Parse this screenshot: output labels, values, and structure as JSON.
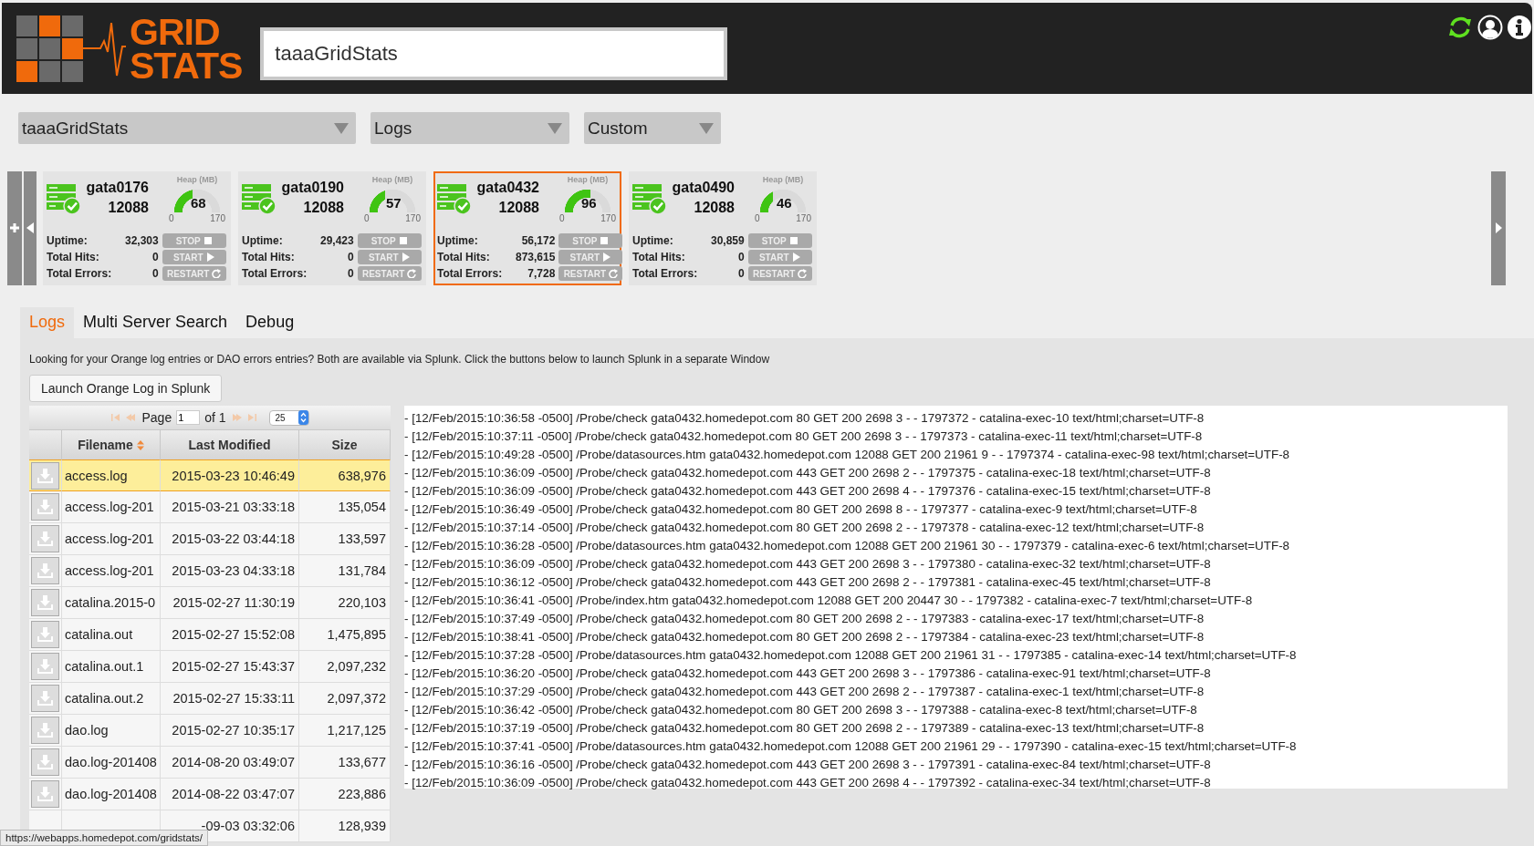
{
  "header": {
    "logo": [
      "GRID",
      "STATS"
    ],
    "search": {
      "value": "taaaGridStats"
    }
  },
  "selectors": [
    {
      "value": "taaaGridStats"
    },
    {
      "value": "Logs"
    },
    {
      "value": "Custom"
    }
  ],
  "servers": [
    {
      "name": "gata0176",
      "port": "12088",
      "heap_label": "Heap (MB)",
      "heap": "68",
      "level": 0.4,
      "min": "0",
      "max": "170",
      "selected": false,
      "stats": [
        {
          "label": "Uptime:",
          "value": "32,303"
        },
        {
          "label": "Total Hits:",
          "value": "0"
        },
        {
          "label": "Total Errors:",
          "value": "0"
        }
      ],
      "actions": [
        {
          "kind": "stop",
          "label": "STOP"
        },
        {
          "kind": "start",
          "label": "START"
        },
        {
          "kind": "restart",
          "label": "RESTART"
        }
      ]
    },
    {
      "name": "gata0190",
      "port": "12088",
      "heap_label": "Heap (MB)",
      "heap": "57",
      "level": 0.335,
      "min": "0",
      "max": "170",
      "selected": false,
      "stats": [
        {
          "label": "Uptime:",
          "value": "29,423"
        },
        {
          "label": "Total Hits:",
          "value": "0"
        },
        {
          "label": "Total Errors:",
          "value": "0"
        }
      ],
      "actions": [
        {
          "kind": "stop",
          "label": "STOP"
        },
        {
          "kind": "start",
          "label": "START"
        },
        {
          "kind": "restart",
          "label": "RESTART"
        }
      ]
    },
    {
      "name": "gata0432",
      "port": "12088",
      "heap_label": "Heap (MB)",
      "heap": "96",
      "level": 0.565,
      "min": "0",
      "max": "170",
      "selected": true,
      "stats": [
        {
          "label": "Uptime:",
          "value": "56,172"
        },
        {
          "label": "Total Hits:",
          "value": "873,615"
        },
        {
          "label": "Total Errors:",
          "value": "7,728"
        }
      ],
      "actions": [
        {
          "kind": "stop",
          "label": "STOP"
        },
        {
          "kind": "start",
          "label": "START"
        },
        {
          "kind": "restart",
          "label": "RESTART"
        }
      ]
    },
    {
      "name": "gata0490",
      "port": "12088",
      "heap_label": "Heap (MB)",
      "heap": "46",
      "level": 0.27,
      "min": "0",
      "max": "170",
      "selected": false,
      "stats": [
        {
          "label": "Uptime:",
          "value": "30,859"
        },
        {
          "label": "Total Hits:",
          "value": "0"
        },
        {
          "label": "Total Errors:",
          "value": "0"
        }
      ],
      "actions": [
        {
          "kind": "stop",
          "label": "STOP"
        },
        {
          "kind": "start",
          "label": "START"
        },
        {
          "kind": "restart",
          "label": "RESTART"
        }
      ]
    }
  ],
  "tabs": [
    {
      "label": "Logs",
      "selected": true
    },
    {
      "label": "Multi Server Search",
      "selected": false
    },
    {
      "label": "Debug",
      "selected": false
    }
  ],
  "logs_panel": {
    "notice": "Looking for your Orange log entries or DAO errors entries? Both are available via Splunk. Click the buttons below to launch Splunk in a separate Window",
    "launch_button": "Launch Orange Log in Splunk",
    "pager": {
      "page_label": "Page",
      "page": "1",
      "of": "of 1",
      "page_size": "25"
    },
    "table": {
      "columns": [
        {
          "label": "Filename",
          "sorted": true
        },
        {
          "label": "Last Modified",
          "sorted": false
        },
        {
          "label": "Size",
          "sorted": false
        }
      ],
      "rows": [
        {
          "filename": "access.log",
          "modified": "2015-03-23 10:46:49",
          "size": "638,976",
          "selected": true
        },
        {
          "filename": "access.log-201",
          "modified": "2015-03-21 03:33:18",
          "size": "135,054",
          "selected": false
        },
        {
          "filename": "access.log-201",
          "modified": "2015-03-22 03:44:18",
          "size": "133,597",
          "selected": false
        },
        {
          "filename": "access.log-201",
          "modified": "2015-03-23 04:33:18",
          "size": "131,784",
          "selected": false
        },
        {
          "filename": "catalina.2015-0",
          "modified": "2015-02-27 11:30:19",
          "size": "220,103",
          "selected": false
        },
        {
          "filename": "catalina.out",
          "modified": "2015-02-27 15:52:08",
          "size": "1,475,895",
          "selected": false
        },
        {
          "filename": "catalina.out.1",
          "modified": "2015-02-27 15:43:37",
          "size": "2,097,232",
          "selected": false
        },
        {
          "filename": "catalina.out.2",
          "modified": "2015-02-27 15:33:11",
          "size": "2,097,372",
          "selected": false
        },
        {
          "filename": "dao.log",
          "modified": "2015-02-27 10:35:17",
          "size": "1,217,125",
          "selected": false
        },
        {
          "filename": "dao.log-201408",
          "modified": "2014-08-20 03:49:07",
          "size": "133,677",
          "selected": false
        },
        {
          "filename": "dao.log-201408",
          "modified": "2014-08-22 03:47:07",
          "size": "223,886",
          "selected": false
        },
        {
          "modified": "-09-03 03:32:06",
          "size": "128,939",
          "selected": false
        }
      ]
    },
    "log_lines": [
      "- [12/Feb/2015:10:36:58 -0500] /Probe/check gata0432.homedepot.com 80 GET 200 2698 3 - - 1797372 - catalina-exec-10 text/html;charset=UTF-8",
      "- [12/Feb/2015:10:37:11 -0500] /Probe/check gata0432.homedepot.com 80 GET 200 2698 3 - - 1797373 - catalina-exec-11 text/html;charset=UTF-8",
      "- [12/Feb/2015:10:49:28 -0500] /Probe/datasources.htm gata0432.homedepot.com 12088 GET 200 21961 9 - - 1797374 - catalina-exec-98 text/html;charset=UTF-8",
      "- [12/Feb/2015:10:36:09 -0500] /Probe/check gata0432.homedepot.com 443 GET 200 2698 2 - - 1797375 - catalina-exec-18 text/html;charset=UTF-8",
      "- [12/Feb/2015:10:36:09 -0500] /Probe/check gata0432.homedepot.com 443 GET 200 2698 4 - - 1797376 - catalina-exec-15 text/html;charset=UTF-8",
      "- [12/Feb/2015:10:36:49 -0500] /Probe/check gata0432.homedepot.com 80 GET 200 2698 8 - - 1797377 - catalina-exec-9 text/html;charset=UTF-8",
      "- [12/Feb/2015:10:37:14 -0500] /Probe/check gata0432.homedepot.com 80 GET 200 2698 2 - - 1797378 - catalina-exec-12 text/html;charset=UTF-8",
      "- [12/Feb/2015:10:36:28 -0500] /Probe/datasources.htm gata0432.homedepot.com 12088 GET 200 21961 30 - - 1797379 - catalina-exec-6 text/html;charset=UTF-8",
      "- [12/Feb/2015:10:36:09 -0500] /Probe/check gata0432.homedepot.com 443 GET 200 2698 3 - - 1797380 - catalina-exec-32 text/html;charset=UTF-8",
      "- [12/Feb/2015:10:36:12 -0500] /Probe/check gata0432.homedepot.com 443 GET 200 2698 2 - - 1797381 - catalina-exec-45 text/html;charset=UTF-8",
      "- [12/Feb/2015:10:36:41 -0500] /Probe/index.htm gata0432.homedepot.com 12088 GET 200 20447 30 - - 1797382 - catalina-exec-7 text/html;charset=UTF-8",
      "- [12/Feb/2015:10:37:49 -0500] /Probe/check gata0432.homedepot.com 80 GET 200 2698 2 - - 1797383 - catalina-exec-17 text/html;charset=UTF-8",
      "- [12/Feb/2015:10:38:41 -0500] /Probe/check gata0432.homedepot.com 80 GET 200 2698 2 - - 1797384 - catalina-exec-23 text/html;charset=UTF-8",
      "- [12/Feb/2015:10:37:28 -0500] /Probe/datasources.htm gata0432.homedepot.com 12088 GET 200 21961 31 - - 1797385 - catalina-exec-14 text/html;charset=UTF-8",
      "- [12/Feb/2015:10:36:20 -0500] /Probe/check gata0432.homedepot.com 443 GET 200 2698 3 - - 1797386 - catalina-exec-91 text/html;charset=UTF-8",
      "- [12/Feb/2015:10:37:29 -0500] /Probe/check gata0432.homedepot.com 443 GET 200 2698 2 - - 1797387 - catalina-exec-1 text/html;charset=UTF-8",
      "- [12/Feb/2015:10:36:42 -0500] /Probe/check gata0432.homedepot.com 80 GET 200 2698 3 - - 1797388 - catalina-exec-8 text/html;charset=UTF-8",
      "- [12/Feb/2015:10:37:19 -0500] /Probe/check gata0432.homedepot.com 80 GET 200 2698 2 - - 1797389 - catalina-exec-13 text/html;charset=UTF-8",
      "- [12/Feb/2015:10:37:41 -0500] /Probe/datasources.htm gata0432.homedepot.com 12088 GET 200 21961 29 - - 1797390 - catalina-exec-15 text/html;charset=UTF-8",
      "- [12/Feb/2015:10:36:16 -0500] /Probe/check gata0432.homedepot.com 443 GET 200 2698 3 - - 1797391 - catalina-exec-84 text/html;charset=UTF-8",
      "- [12/Feb/2015:10:36:09 -0500] /Probe/check gata0432.homedepot.com 443 GET 200 2698 4 - - 1797392 - catalina-exec-34 text/html;charset=UTF-8"
    ]
  },
  "status_url": "https://webapps.homedepot.com/gridstats/"
}
